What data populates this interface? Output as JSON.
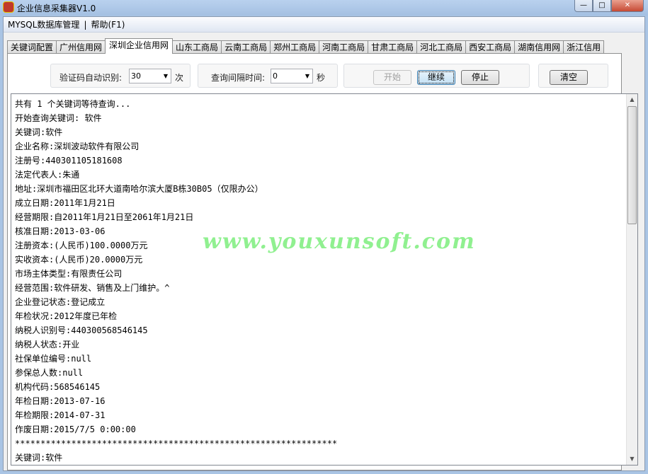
{
  "window": {
    "title": "企业信息采集器V1.0",
    "min": "—",
    "max": "□",
    "close": "✕"
  },
  "menu": [
    "MYSQL数据库管理",
    "|",
    "帮助(F1)"
  ],
  "tabs": [
    "关键词配置",
    "广州信用网",
    "深圳企业信用网",
    "山东工商局",
    "云南工商局",
    "郑州工商局",
    "河南工商局",
    "甘肃工商局",
    "河北工商局",
    "西安工商局",
    "湖南信用网",
    "浙江信用"
  ],
  "active_tab": 2,
  "controls": {
    "captcha_label": "验证码自动识别:",
    "captcha_value": "30",
    "captcha_unit": "次",
    "interval_label": "查询间隔时间:",
    "interval_value": "0",
    "interval_unit": "秒",
    "start": "开始",
    "continue": "继续",
    "stop": "停止",
    "clear": "清空"
  },
  "log_lines": [
    "共有 1 个关键词等待查询...",
    "开始查询关键词: 软件",
    "关键词:软件",
    "企业名称:深圳波动软件有限公司",
    "注册号:440301105181608",
    "法定代表人:朱通",
    "地址:深圳市福田区北环大道南哈尔滨大厦B栋30B05（仅限办公）",
    "成立日期:2011年1月21日",
    "经营期限:自2011年1月21日至2061年1月21日",
    "核准日期:2013-03-06",
    "注册资本:(人民币)100.0000万元",
    "实收资本:(人民币)20.0000万元",
    "市场主体类型:有限责任公司",
    "经营范围:软件研发、销售及上门维护。^",
    "企业登记状态:登记成立",
    "年检状况:2012年度已年检",
    "纳税人识别号:440300568546145",
    "纳税人状态:开业",
    "社保单位编号:null",
    "参保总人数:null",
    "机构代码:568546145",
    "年检日期:2013-07-16",
    "年检期限:2014-07-31",
    "作废日期:2015/7/5 0:00:00",
    "***************************************************************",
    "关键词:软件"
  ],
  "watermark": "www.youxunsoft.com"
}
